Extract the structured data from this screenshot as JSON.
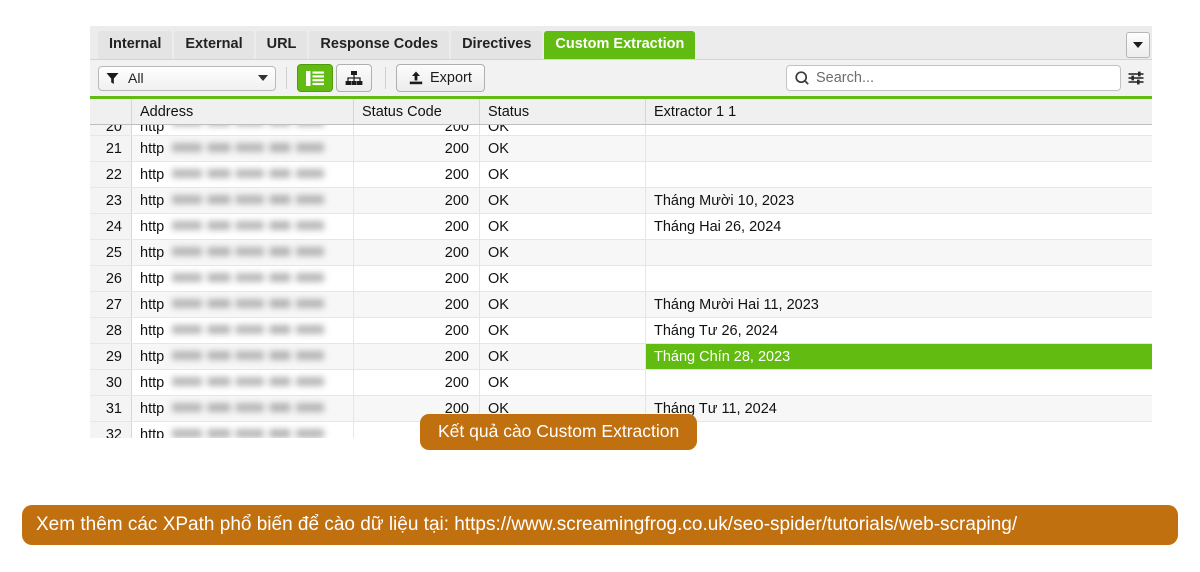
{
  "app": {
    "tabs": [
      {
        "label": "Internal",
        "active": false
      },
      {
        "label": "External",
        "active": false
      },
      {
        "label": "URL",
        "active": false
      },
      {
        "label": "Response Codes",
        "active": false
      },
      {
        "label": "Directives",
        "active": false
      },
      {
        "label": "Custom Extraction",
        "active": true
      }
    ],
    "tab_overflow_icon": "chevron-down-icon",
    "accent_green": "#61bb10",
    "toolbar": {
      "filter_icon": "funnel-icon",
      "filter_value": "All",
      "filter_arrow_icon": "chevron-down-icon",
      "list_view_icon": "list-view-icon",
      "tree_view_icon": "tree-view-icon",
      "export_icon": "upload-icon",
      "export_label": "Export",
      "search_icon": "search-icon",
      "search_value": "",
      "search_placeholder": "Search...",
      "search_options_icon": "sliders-icon"
    },
    "table": {
      "columns": [
        "",
        "Address",
        "Status Code",
        "Status",
        "Extractor 1 1"
      ],
      "rows": [
        {
          "num": "20",
          "proto": "http",
          "code": "200",
          "status": "OK",
          "extractor": "",
          "clipped": true,
          "selected": false
        },
        {
          "num": "21",
          "proto": "http",
          "code": "200",
          "status": "OK",
          "extractor": "",
          "clipped": false,
          "selected": false
        },
        {
          "num": "22",
          "proto": "http",
          "code": "200",
          "status": "OK",
          "extractor": "",
          "clipped": false,
          "selected": false
        },
        {
          "num": "23",
          "proto": "http",
          "code": "200",
          "status": "OK",
          "extractor": "Tháng Mười 10, 2023",
          "clipped": false,
          "selected": false
        },
        {
          "num": "24",
          "proto": "http",
          "code": "200",
          "status": "OK",
          "extractor": "Tháng Hai 26, 2024",
          "clipped": false,
          "selected": false
        },
        {
          "num": "25",
          "proto": "http",
          "code": "200",
          "status": "OK",
          "extractor": "",
          "clipped": false,
          "selected": false
        },
        {
          "num": "26",
          "proto": "http",
          "code": "200",
          "status": "OK",
          "extractor": "",
          "clipped": false,
          "selected": false
        },
        {
          "num": "27",
          "proto": "http",
          "code": "200",
          "status": "OK",
          "extractor": "Tháng Mười Hai 11, 2023",
          "clipped": false,
          "selected": false
        },
        {
          "num": "28",
          "proto": "http",
          "code": "200",
          "status": "OK",
          "extractor": "Tháng Tư 26, 2024",
          "clipped": false,
          "selected": false
        },
        {
          "num": "29",
          "proto": "http",
          "code": "200",
          "status": "OK",
          "extractor": "Tháng Chín 28, 2023",
          "clipped": false,
          "selected": true
        },
        {
          "num": "30",
          "proto": "http",
          "code": "200",
          "status": "OK",
          "extractor": "",
          "clipped": false,
          "selected": false
        },
        {
          "num": "31",
          "proto": "http",
          "code": "200",
          "status": "OK",
          "extractor": "Tháng Tư 11, 2024",
          "clipped": false,
          "selected": false
        },
        {
          "num": "32",
          "proto": "http",
          "code": "",
          "status": "",
          "extractor": "",
          "clipped": false,
          "selected": false
        }
      ]
    }
  },
  "annotations": {
    "caption_badge": "Kết quả cào Custom Extraction",
    "bottom_banner": "Xem thêm các XPath phổ biến để cào dữ liệu tại: https://www.screamingfrog.co.uk/seo-spider/tutorials/web-scraping/",
    "badge_color": "#c1700f"
  }
}
